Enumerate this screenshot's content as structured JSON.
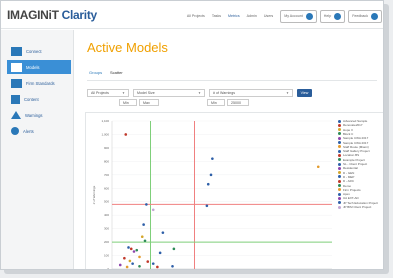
{
  "header": {
    "brand_part1": "IMAGINiT",
    "brand_part2": "Clarity",
    "nav": [
      "All Projects",
      "Tasks",
      "Metrics",
      "Admin",
      "Users"
    ],
    "active_nav": "Metrics",
    "account_label": "My Account",
    "help_label": "Help",
    "feedback_label": "Feedback"
  },
  "sidebar": {
    "items": [
      {
        "label": "Connect",
        "icon": "monitor-icon"
      },
      {
        "label": "Models",
        "icon": "cube-icon",
        "active": true
      },
      {
        "label": "Firm Standards",
        "icon": "book-icon"
      },
      {
        "label": "Content",
        "icon": "document-icon"
      },
      {
        "label": "Warnings",
        "icon": "warning-icon"
      },
      {
        "label": "Alerts",
        "icon": "alert-icon"
      }
    ]
  },
  "main": {
    "title": "Active Models",
    "tabs": [
      "Groups",
      "Scatter"
    ],
    "active_tab": "Groups",
    "filters": {
      "project": "All Projects",
      "x_metric": "Model Size",
      "y_metric": "# of Warnings",
      "x_min": "Min",
      "x_max": "Max",
      "y_min": "Min",
      "y_max": "25000",
      "view_button": "View"
    }
  },
  "chart_data": {
    "type": "scatter",
    "ylabel": "# of Warnings",
    "y_ticks": [
      "0",
      "100",
      "200",
      "300",
      "400",
      "500",
      "600",
      "700",
      "800",
      "900",
      "1,000",
      "1,100"
    ],
    "ylim": [
      0,
      1100
    ],
    "points": [
      {
        "x": 0.1,
        "y": 1000,
        "color": "#c0392b"
      },
      {
        "x": 0.72,
        "y": 700,
        "color": "#2e5fa8"
      },
      {
        "x": 0.7,
        "y": 630,
        "color": "#2e5fa8"
      },
      {
        "x": 0.69,
        "y": 470,
        "color": "#2e5fa8"
      },
      {
        "x": 0.73,
        "y": 820,
        "color": "#2e5fa8"
      },
      {
        "x": 1.5,
        "y": 760,
        "color": "#e39b2e"
      },
      {
        "x": 0.25,
        "y": 480,
        "color": "#2e5fa8"
      },
      {
        "x": 0.3,
        "y": 440,
        "color": "#c3a6d4"
      },
      {
        "x": 0.23,
        "y": 330,
        "color": "#2e5fa8"
      },
      {
        "x": 0.22,
        "y": 240,
        "color": "#d4a72c"
      },
      {
        "x": 0.24,
        "y": 210,
        "color": "#2e8b57"
      },
      {
        "x": 0.12,
        "y": 160,
        "color": "#2e5fa8"
      },
      {
        "x": 0.14,
        "y": 150,
        "color": "#c0392b"
      },
      {
        "x": 0.18,
        "y": 140,
        "color": "#2e8b57"
      },
      {
        "x": 0.16,
        "y": 130,
        "color": "#8e44ad"
      },
      {
        "x": 0.37,
        "y": 270,
        "color": "#2e5fa8"
      },
      {
        "x": 0.45,
        "y": 150,
        "color": "#2e8b57"
      },
      {
        "x": 0.35,
        "y": 120,
        "color": "#2e5fa8"
      },
      {
        "x": 0.2,
        "y": 90,
        "color": "#e39b2e"
      },
      {
        "x": 0.09,
        "y": 80,
        "color": "#c0392b"
      },
      {
        "x": 0.13,
        "y": 60,
        "color": "#d4a72c"
      },
      {
        "x": 0.15,
        "y": 40,
        "color": "#2e5fa8"
      },
      {
        "x": 0.26,
        "y": 55,
        "color": "#c0392b"
      },
      {
        "x": 0.3,
        "y": 40,
        "color": "#2e5fa8"
      },
      {
        "x": 0.06,
        "y": 30,
        "color": "#8e44ad"
      },
      {
        "x": 0.2,
        "y": 20,
        "color": "#2e8b57"
      },
      {
        "x": 0.11,
        "y": 15,
        "color": "#e39b2e"
      },
      {
        "x": 0.33,
        "y": 15,
        "color": "#c0392b"
      },
      {
        "x": 0.44,
        "y": 20,
        "color": "#2e5fa8"
      }
    ],
    "xlim": [
      0,
      1.6
    ],
    "vertical_lines": [
      {
        "x": 0.28,
        "color": "#7fcf7a"
      },
      {
        "x": 0.6,
        "color": "#f08080"
      }
    ],
    "horizontal_lines": [
      {
        "y": 480,
        "color": "#f08080"
      },
      {
        "y": 200,
        "color": "#7fcf7a"
      }
    ],
    "legend": [
      {
        "label": "Advanced Sample",
        "color": "#2e5fa8"
      },
      {
        "label": "Renovate2017",
        "color": "#c0392b"
      },
      {
        "label": "Hope II",
        "color": "#d4a72c"
      },
      {
        "label": "Block C",
        "color": "#2e8b57"
      },
      {
        "label": "Sample CWA 2017",
        "color": "#8e44ad"
      },
      {
        "label": "Sample CWA 2017",
        "color": "#2e5fa8"
      },
      {
        "label": "Staff Route (Miami)",
        "color": "#e39b2e"
      },
      {
        "label": "Staff Gallery Project",
        "color": "#2e5fa8"
      },
      {
        "label": "Location BS",
        "color": "#c0392b"
      },
      {
        "label": "Example Project",
        "color": "#2e8b57"
      },
      {
        "label": "SL - Client Project",
        "color": "#2e5fa8"
      },
      {
        "label": "Residential",
        "color": "#8e44ad"
      },
      {
        "label": "D - GEN",
        "color": "#d4a72c"
      },
      {
        "label": "D - MEP",
        "color": "#2e5fa8"
      },
      {
        "label": "D - ARC",
        "color": "#c0392b"
      },
      {
        "label": "Demo",
        "color": "#2e8b57"
      },
      {
        "label": "Firm Projects",
        "color": "#e39b2e"
      },
      {
        "label": "Apex",
        "color": "#2e5fa8"
      },
      {
        "label": "UA EXT-AD",
        "color": "#8e44ad"
      },
      {
        "label": "JP Tech Education Project",
        "color": "#2e5fa8"
      },
      {
        "label": "JP BIM Client Project",
        "color": "#c3a6d4"
      }
    ]
  }
}
